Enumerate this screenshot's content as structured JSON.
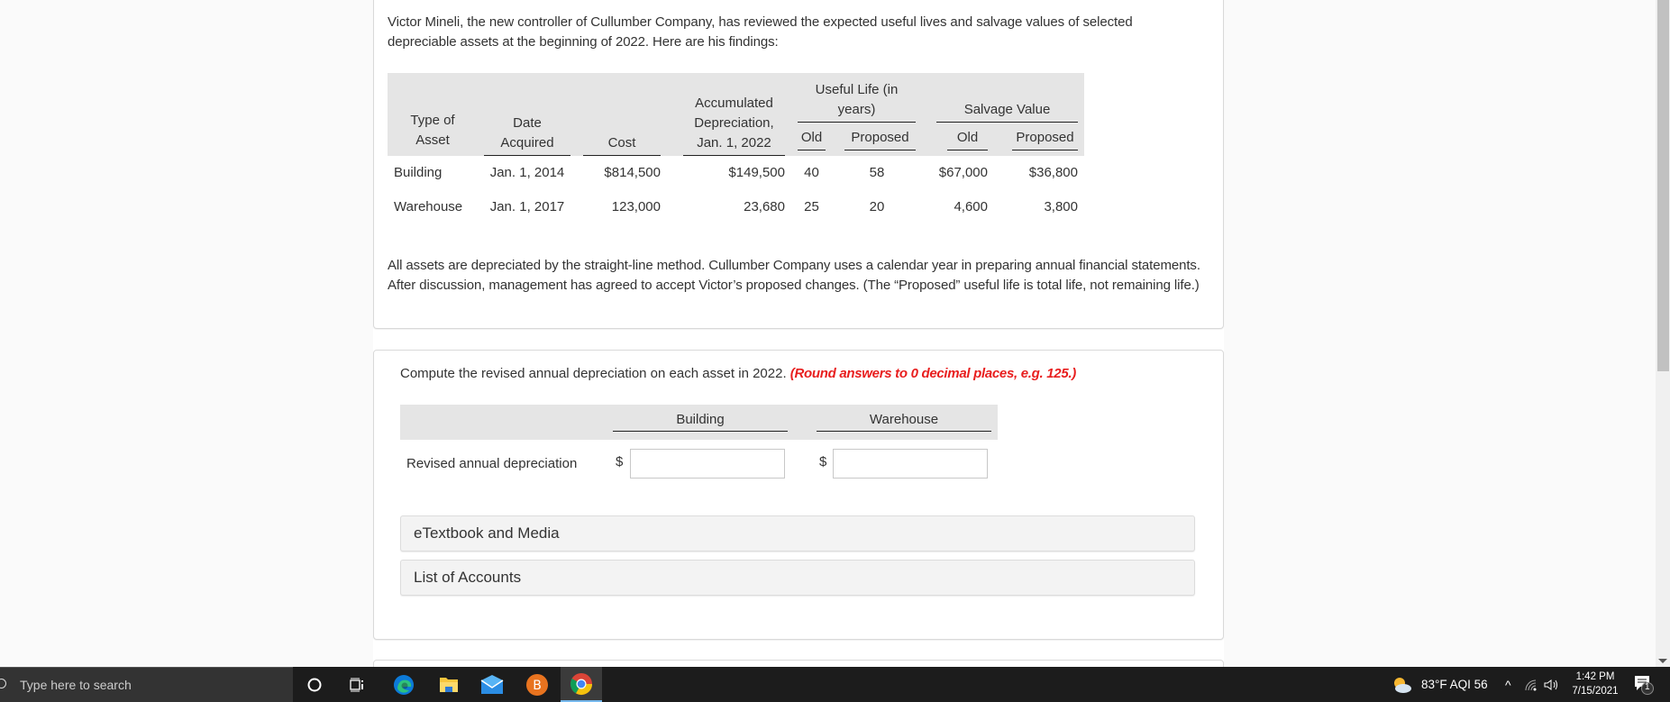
{
  "problem": {
    "intro": "Victor Mineli, the new controller of Cullumber Company, has reviewed the expected useful lives and salvage values of selected depreciable assets at the beginning of 2022. Here are his findings:",
    "table": {
      "headers": {
        "type_of_asset": [
          "Type of",
          "Asset"
        ],
        "date_acquired": [
          "Date",
          "Acquired"
        ],
        "cost": "Cost",
        "accumulated_depreciation": [
          "Accumulated",
          "Depreciation,",
          "Jan. 1, 2022"
        ],
        "useful_life_group": "Useful Life (in years)",
        "salvage_value_group": "Salvage Value",
        "old": "Old",
        "proposed": "Proposed"
      },
      "rows": [
        {
          "type": "Building",
          "date": "Jan. 1, 2014",
          "cost": "$814,500",
          "accum_dep": "$149,500",
          "life_old": "40",
          "life_proposed": "58",
          "salvage_old": "$67,000",
          "salvage_proposed": "$36,800"
        },
        {
          "type": "Warehouse",
          "date": "Jan. 1, 2017",
          "cost": "123,000",
          "accum_dep": "23,680",
          "life_old": "25",
          "life_proposed": "20",
          "salvage_old": "4,600",
          "salvage_proposed": "3,800"
        }
      ]
    },
    "closing": "All assets are depreciated by the straight-line method. Cullumber Company uses a calendar year in preparing annual financial statements. After discussion, management has agreed to accept Victor’s proposed changes. (The “Proposed” useful life is total life, not remaining life.)"
  },
  "question": {
    "prompt": "Compute the revised annual depreciation on each asset in 2022.",
    "instruction": "(Round answers to 0 decimal places, e.g. 125.)",
    "columns": [
      "Building",
      "Warehouse"
    ],
    "row_label": "Revised annual depreciation",
    "currency_symbol": "$",
    "inputs": {
      "building": "",
      "warehouse": ""
    },
    "accordions": [
      "eTextbook and Media",
      "List of Accounts"
    ],
    "instruction_color": "#e81e1e"
  },
  "taskbar": {
    "search_placeholder": "Type here to search",
    "apps": [
      "cortana",
      "task-view",
      "edge",
      "file-explorer",
      "mail",
      "app-b",
      "chrome"
    ],
    "weather": "83°F  AQI 56",
    "time": "1:42 PM",
    "date": "7/15/2021",
    "notification_count": "1"
  }
}
